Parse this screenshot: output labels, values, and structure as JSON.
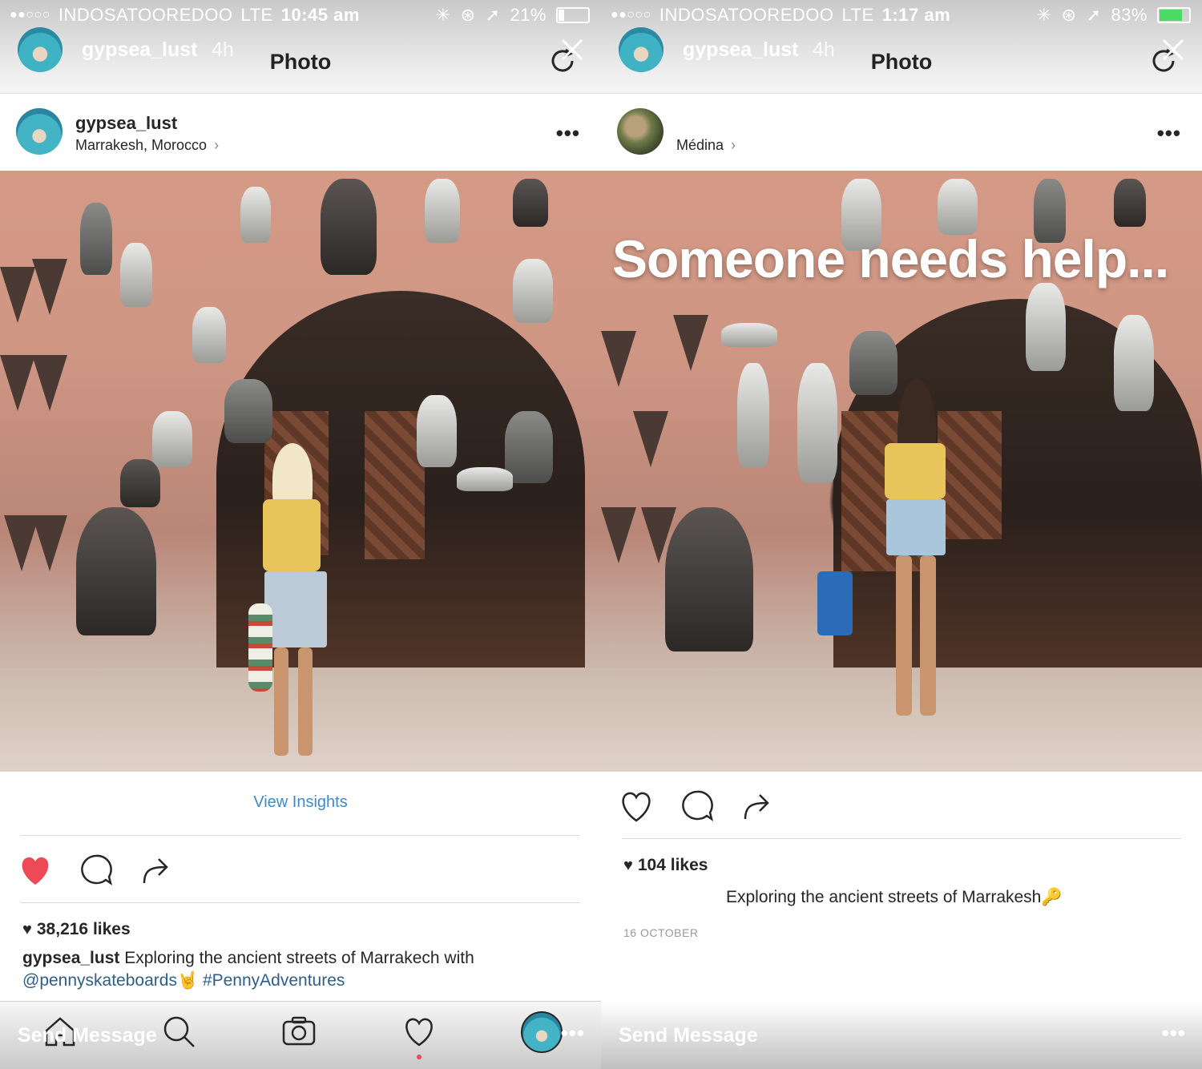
{
  "left": {
    "status_bar": {
      "signal": "●●○○○",
      "carrier": "INDOSATOOREDOO",
      "network": "LTE",
      "time": "10:45 am",
      "battery_percent": "21%",
      "battery_level": 0.21,
      "battery_color": "#ffffff"
    },
    "story": {
      "username": "gypsea_lust",
      "time_ago": "4h",
      "title": "Photo"
    },
    "post": {
      "username": "gypsea_lust",
      "location": "Marrakesh, Morocco",
      "view_insights": "View Insights",
      "liked": true,
      "likes": "38,216 likes",
      "caption_user": "gypsea_lust",
      "caption_text": "Exploring the ancient streets of Marrakech with",
      "caption_mention": "@pennyskateboards",
      "caption_emoji": "🤘",
      "caption_hashtag": "#PennyAdventures"
    },
    "bottom_bar": {
      "send_message": "Send Message",
      "more": "•••"
    }
  },
  "right": {
    "status_bar": {
      "signal": "●●○○○",
      "carrier": "INDOSATOOREDOO",
      "network": "LTE",
      "time": "1:17 am",
      "battery_percent": "83%",
      "battery_level": 0.83,
      "battery_color": "#4cd964"
    },
    "story": {
      "username": "gypsea_lust",
      "time_ago": "4h",
      "title": "Photo"
    },
    "post": {
      "username": "",
      "location": "Médina",
      "overlay_text": "Someone needs help...",
      "liked": false,
      "likes": "104 likes",
      "caption_text": "Exploring the ancient streets of Marrakesh🔑",
      "date": "16 OCTOBER"
    },
    "bottom_bar": {
      "send_message": "Send Message",
      "more": "•••"
    }
  },
  "colors": {
    "like_red": "#ed4956",
    "link_blue": "#3a8bc9",
    "text": "#262626"
  },
  "icons": [
    "home-icon",
    "search-icon",
    "camera-icon",
    "heart-icon",
    "comment-icon",
    "share-icon",
    "refresh-icon",
    "close-icon",
    "more-icon"
  ]
}
